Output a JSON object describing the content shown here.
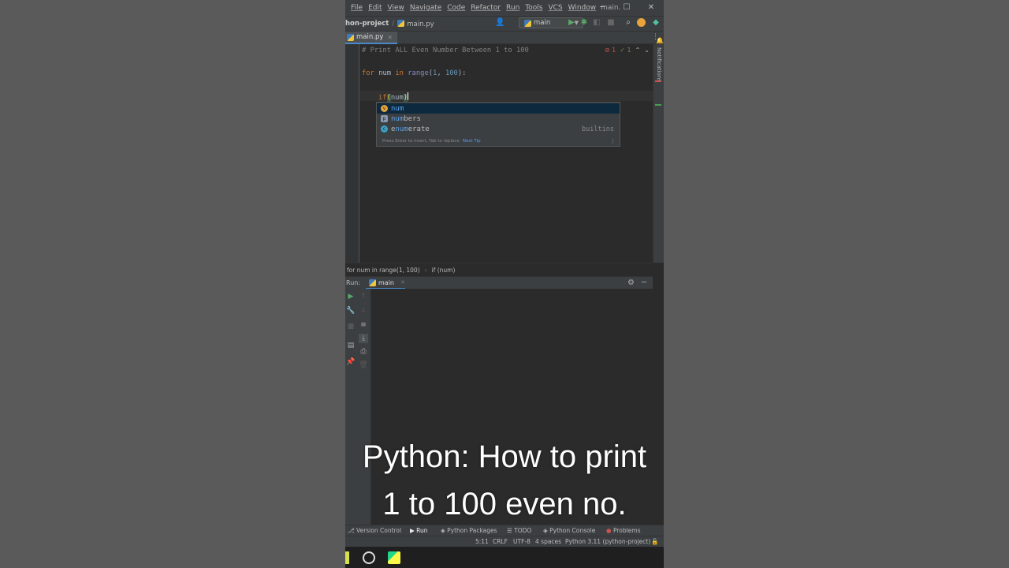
{
  "menu": {
    "items": [
      "File",
      "Edit",
      "View",
      "Navigate",
      "Code",
      "Refactor",
      "Run",
      "Tools",
      "VCS",
      "Window"
    ],
    "window_title": "main."
  },
  "navbar": {
    "project": "hon-project",
    "file": "main.py",
    "run_config": "main"
  },
  "editor_tab": {
    "label": "main.py"
  },
  "editor": {
    "line1_comment": "# Print ALL Even Number Between 1 to 100",
    "line2": {
      "kw_for": "for",
      "var": "num",
      "kw_in": "in",
      "fn": "range",
      "open": "(",
      "n1": "1",
      "comma": ", ",
      "n2": "100",
      "close": "):"
    },
    "line3": {
      "kw_if": "if",
      "paren": "(",
      "typed": "num",
      "close_paren": ")"
    },
    "inspection": {
      "errors": "1",
      "ok": "1"
    }
  },
  "completion": {
    "items": [
      {
        "icon": "variable-icon",
        "match": "num",
        "rest": "",
        "tail": ""
      },
      {
        "icon": "parameter-icon",
        "match": "n",
        "rest2_match": "um",
        "text": "numbers",
        "tail": ""
      },
      {
        "icon": "class-icon",
        "text": "enumerate",
        "tail": "builtins"
      }
    ],
    "item1_a": "num",
    "item2_a": "n",
    "item2_b": "um",
    "item2_c": "bers",
    "item3_a": "e",
    "item3_b": "num",
    "item3_c": "erate",
    "item3_tail": "builtins",
    "footer": "Press Enter to insert, Tab to replace",
    "footer_link": "Next Tip"
  },
  "breadcrumbs": {
    "first": "for num in range(1, 100)",
    "second": "if (num)"
  },
  "run": {
    "label": "Run:",
    "tab": "main"
  },
  "notifications_label": "Notifications",
  "toolwindows": [
    "Version Control",
    "Run",
    "Python Packages",
    "TODO",
    "Python Console",
    "Problems"
  ],
  "status": {
    "position": "5:11",
    "line_sep": "CRLF",
    "encoding": "UTF-8",
    "indent": "4 spaces",
    "interpreter": "Python 3.11 (python-project)"
  },
  "caption": {
    "line1": "Python: How to print",
    "line2": "1 to 100 even no."
  },
  "colors": {
    "keyword": "#cc7832",
    "number": "#6897bb",
    "builtin": "#8888c6",
    "accent": "#4a88c7"
  }
}
